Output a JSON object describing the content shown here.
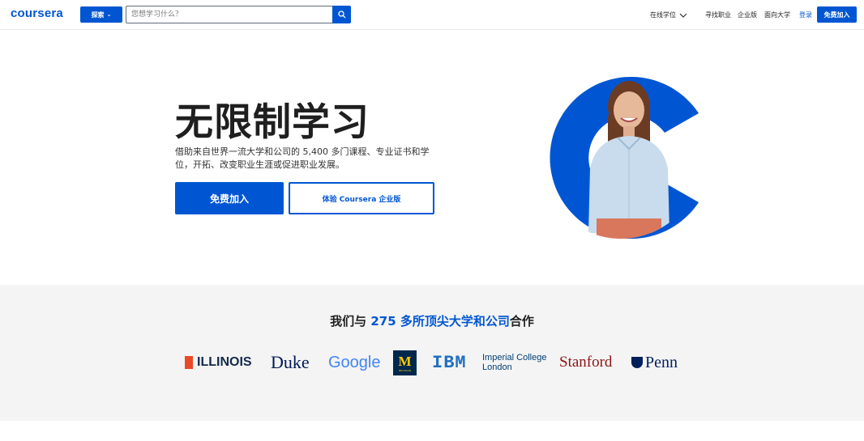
{
  "header": {
    "logo_text": "coursera",
    "explore_label": "探索",
    "search_placeholder": "您想学习什么？",
    "nav_degree": "在线学位",
    "nav_links": [
      "寻找职业",
      "企业版",
      "面向大学"
    ],
    "login_label": "登录",
    "join_label": "免费加入"
  },
  "hero": {
    "title": "无限制学习",
    "description": "借助来自世界一流大学和公司的 5,400 多门课程、专业证书和学位，开拓、改变职业生涯或促进职业发展。",
    "primary_button": "免费加入",
    "secondary_button": "体验 Coursera 企业版"
  },
  "partners": {
    "title_prefix": "我们与 ",
    "title_highlight": "275 多所顶尖大学和公司",
    "title_suffix": "合作",
    "logos": {
      "illinois": "ILLINOIS",
      "duke": "Duke",
      "google": "Google",
      "michigan": "M",
      "michigan_sub": "MICHIGAN",
      "ibm": "IBM",
      "imperial_line1": "Imperial College",
      "imperial_line2": "London",
      "stanford": "Stanford",
      "penn": "Penn"
    }
  },
  "colors": {
    "brand_blue": "#0056d2",
    "text": "#1f1f1f",
    "section_bg": "#f4f4f4"
  }
}
